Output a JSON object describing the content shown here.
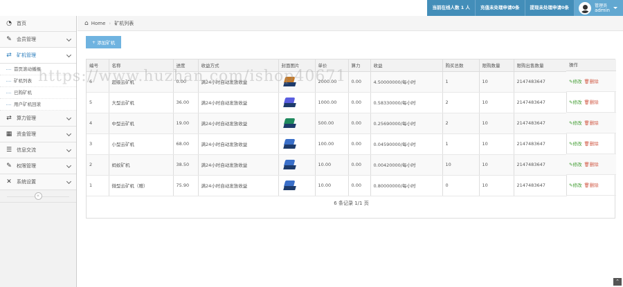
{
  "topbar": {
    "online_label": "当前在线人数 1 人",
    "recharge_label": "充值未处理申请0条",
    "withdraw_label": "提现未处理申请0条",
    "user_role": "管理员",
    "user_name": "admin"
  },
  "sidebar": {
    "items": [
      {
        "label": "首页",
        "icon": "dashboard-icon"
      },
      {
        "label": "会员管理",
        "icon": "edit-icon"
      },
      {
        "label": "矿机管理",
        "icon": "shuffle-icon"
      },
      {
        "label": "算力管理",
        "icon": "shuffle-icon"
      },
      {
        "label": "资金管理",
        "icon": "calendar-icon"
      },
      {
        "label": "信息交流",
        "icon": "list-icon"
      },
      {
        "label": "权限管理",
        "icon": "edit-icon"
      },
      {
        "label": "系统设置",
        "icon": "tools-icon"
      }
    ],
    "sub_items": [
      "首页滚动播报",
      "矿机列表",
      "已购矿机",
      "用户矿机回滚"
    ]
  },
  "breadcrumb": {
    "home": "Home",
    "current": "矿机列表"
  },
  "toolbar": {
    "add_label": "添加矿机"
  },
  "table": {
    "headers": [
      "编号",
      "名称",
      "进度",
      "收益方式",
      "封面图片",
      "单价",
      "算力",
      "收益",
      "购买总数",
      "限购数量",
      "限购出售数量",
      "操作"
    ],
    "rows": [
      {
        "id": "6",
        "name": "超级云矿机",
        "progress": "0.00",
        "mode": "满24小时自动发放收益",
        "color": "t-orange",
        "price": "2000.00",
        "power": "0.00",
        "income": "4.50000000/每小时",
        "total": "1",
        "limit": "10",
        "sold": "2147483647"
      },
      {
        "id": "5",
        "name": "大型云矿机",
        "progress": "36.00",
        "mode": "满24小时自动发放收益",
        "color": "t-purple",
        "price": "1000.00",
        "power": "0.00",
        "income": "0.58330000/每小时",
        "total": "2",
        "limit": "10",
        "sold": "2147483647"
      },
      {
        "id": "4",
        "name": "中型云矿机",
        "progress": "19.00",
        "mode": "满24小时自动发放收益",
        "color": "t-green",
        "price": "500.00",
        "power": "0.00",
        "income": "0.25690000/每小时",
        "total": "2",
        "limit": "10",
        "sold": "2147483647"
      },
      {
        "id": "3",
        "name": "小型云矿机",
        "progress": "68.00",
        "mode": "满24小时自动发放收益",
        "color": "t-blue",
        "price": "100.00",
        "power": "0.00",
        "income": "0.04590000/每小时",
        "total": "1",
        "limit": "10",
        "sold": "2147483647"
      },
      {
        "id": "2",
        "name": "蚂蚁矿机",
        "progress": "38.50",
        "mode": "满24小时自动发放收益",
        "color": "t-blue",
        "price": "10.00",
        "power": "0.00",
        "income": "0.00420000/每小时",
        "total": "10",
        "limit": "10",
        "sold": "2147483647"
      },
      {
        "id": "1",
        "name": "微型云矿机（赠）",
        "progress": "75.90",
        "mode": "满24小时自动发放收益",
        "color": "t-blue",
        "price": "10.00",
        "power": "0.00",
        "income": "0.80000000/每小时",
        "total": "0",
        "limit": "10",
        "sold": "2147483647"
      }
    ],
    "edit_label": "修改",
    "delete_label": "删除"
  },
  "pager": {
    "text": "6 条记录 1/1 页"
  },
  "watermark": "https://www.huzhan.com/ishop40671",
  "colors": {
    "accent": "#438eb9",
    "button": "#6fb3e0",
    "edit": "#3c9a2d",
    "delete": "#d15b47"
  }
}
